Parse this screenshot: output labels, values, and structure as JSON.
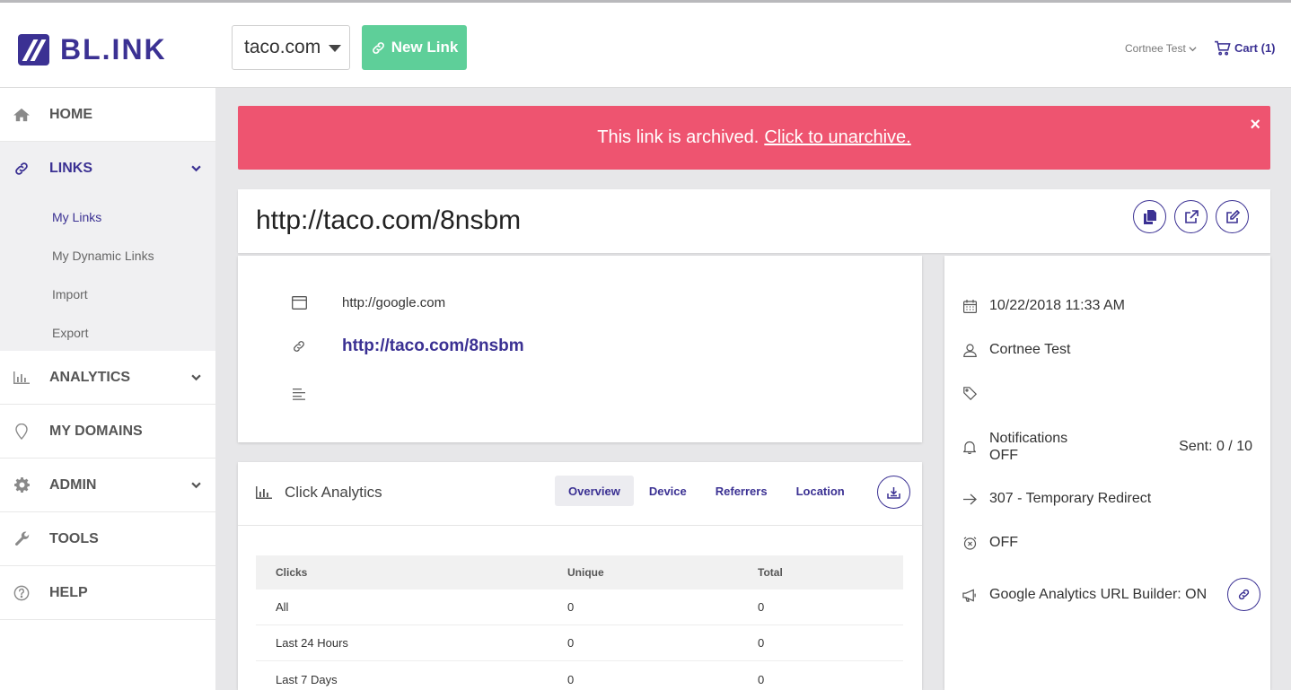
{
  "brand": {
    "name": "BL.INK",
    "accent": "#3b3193",
    "new_link_color": "#5ecf99",
    "alert_color": "#ee5470"
  },
  "header": {
    "domain_select": "taco.com",
    "new_link_label": "New Link",
    "user_name": "Cortnee Test",
    "cart_label": "Cart (1)"
  },
  "sidebar": {
    "items": [
      {
        "label": "HOME",
        "icon": "home-icon"
      },
      {
        "label": "LINKS",
        "icon": "link-icon",
        "active": true
      },
      {
        "label": "ANALYTICS",
        "icon": "bar-chart-icon"
      },
      {
        "label": "MY DOMAINS",
        "icon": "map-pin-icon"
      },
      {
        "label": "ADMIN",
        "icon": "gear-icon"
      },
      {
        "label": "TOOLS",
        "icon": "wrench-icon"
      },
      {
        "label": "HELP",
        "icon": "help-circle-icon"
      }
    ],
    "subitems": [
      "My Links",
      "My Dynamic Links",
      "Import",
      "Export"
    ]
  },
  "alert": {
    "text": "This link is archived.",
    "link_text": "Click to unarchive.",
    "close": "×"
  },
  "link": {
    "short_url": "http://taco.com/8nsbm",
    "destination": "http://google.com",
    "short_link": "http://taco.com/8nsbm",
    "description": ""
  },
  "analytics": {
    "title": "Click Analytics",
    "tabs": [
      "Overview",
      "Device",
      "Referrers",
      "Location"
    ],
    "active_tab": "Overview",
    "columns": [
      "Clicks",
      "Unique",
      "Total"
    ],
    "rows": [
      {
        "label": "All",
        "unique": "0",
        "total": "0"
      },
      {
        "label": "Last 24 Hours",
        "unique": "0",
        "total": "0"
      },
      {
        "label": "Last 7 Days",
        "unique": "0",
        "total": "0"
      }
    ]
  },
  "meta": {
    "created": "10/22/2018 11:33 AM",
    "owner": "Cortnee Test",
    "tags": "",
    "notifications_label": "Notifications",
    "notifications_state": "OFF",
    "notifications_sent": "Sent: 0 / 10",
    "redirect": "307 - Temporary Redirect",
    "expiry_state": "OFF",
    "ga_builder": "Google Analytics URL Builder: ON"
  }
}
